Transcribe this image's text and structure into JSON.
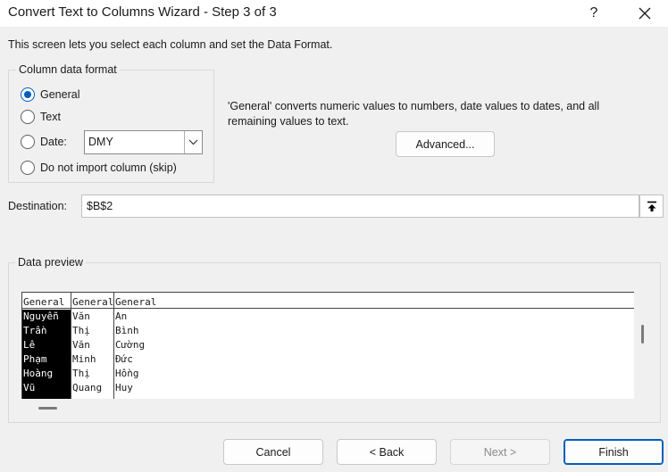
{
  "window": {
    "title": "Convert Text to Columns Wizard - Step 3 of 3",
    "help_label": "?"
  },
  "intro_text": "This screen lets you select each column and set the Data Format.",
  "column_format": {
    "group_title": "Column data format",
    "options": [
      {
        "label": "General",
        "checked": true
      },
      {
        "label": "Text",
        "checked": false
      },
      {
        "label": "Date:",
        "checked": false
      },
      {
        "label": "Do not import column (skip)",
        "checked": false
      }
    ],
    "date_value": "DMY"
  },
  "info_text": "'General' converts numeric values to numbers, date values to dates, and all remaining values to text.",
  "advanced_label": "Advanced...",
  "destination": {
    "label": "Destination:",
    "value": "$B$2"
  },
  "preview": {
    "title": "Data preview",
    "headers": [
      "General",
      "General",
      "General"
    ],
    "rows": [
      [
        "Nguyễn",
        "Văn",
        "An"
      ],
      [
        "Trần",
        "Thị",
        "Bình"
      ],
      [
        "Lê",
        "Văn",
        "Cường"
      ],
      [
        "Phạm",
        "Minh",
        "Đức"
      ],
      [
        "Hoàng",
        "Thị",
        "Hồng"
      ],
      [
        "Vũ",
        "Quang",
        "Huy"
      ]
    ]
  },
  "buttons": {
    "cancel": "Cancel",
    "back": "< Back",
    "next": "Next >",
    "finish": "Finish"
  },
  "colors": {
    "accent": "#005fb8",
    "background": "#f0f0f0"
  }
}
